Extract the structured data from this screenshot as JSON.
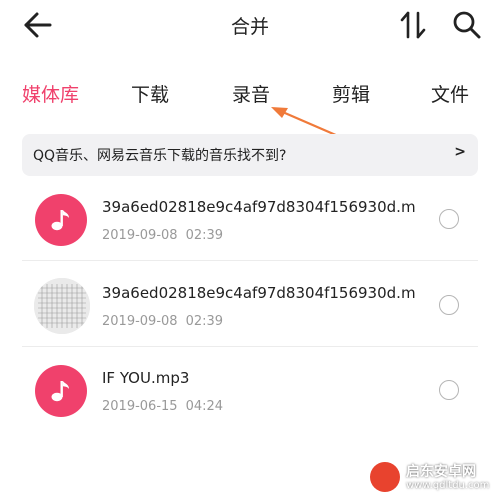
{
  "header": {
    "title": "合并",
    "back_icon": "arrow-left-icon",
    "sort_icon": "sort-updown-icon",
    "search_icon": "search-icon"
  },
  "tabs": [
    {
      "label": "媒体库",
      "active": true
    },
    {
      "label": "下载",
      "active": false
    },
    {
      "label": "录音",
      "active": false
    },
    {
      "label": "剪辑",
      "active": false
    },
    {
      "label": "文件",
      "active": false
    }
  ],
  "banner": {
    "text": "QQ音乐、网易云音乐下载的音乐找不到?",
    "chevron": ">"
  },
  "files": [
    {
      "name": "39a6ed02818e9c4af97d8304f156930d.m",
      "date": "2019-09-08",
      "time": "02:39",
      "thumb": "music-note-icon",
      "selected": false
    },
    {
      "name": "39a6ed02818e9c4af97d8304f156930d.m",
      "date": "2019-09-08",
      "time": "02:39",
      "thumb": "image-thumbnail",
      "selected": false
    },
    {
      "name": "IF YOU.mp3",
      "date": "2019-06-15",
      "time": "04:24",
      "thumb": "music-note-icon",
      "selected": false
    }
  ],
  "watermark": {
    "text": "启东安卓网",
    "url": "www.qdltdu.com"
  },
  "colors": {
    "accent": "#f0416c",
    "annotation_arrow": "#f07a3a",
    "banner_bg": "#f1f1f3",
    "meta_text": "#999999"
  }
}
